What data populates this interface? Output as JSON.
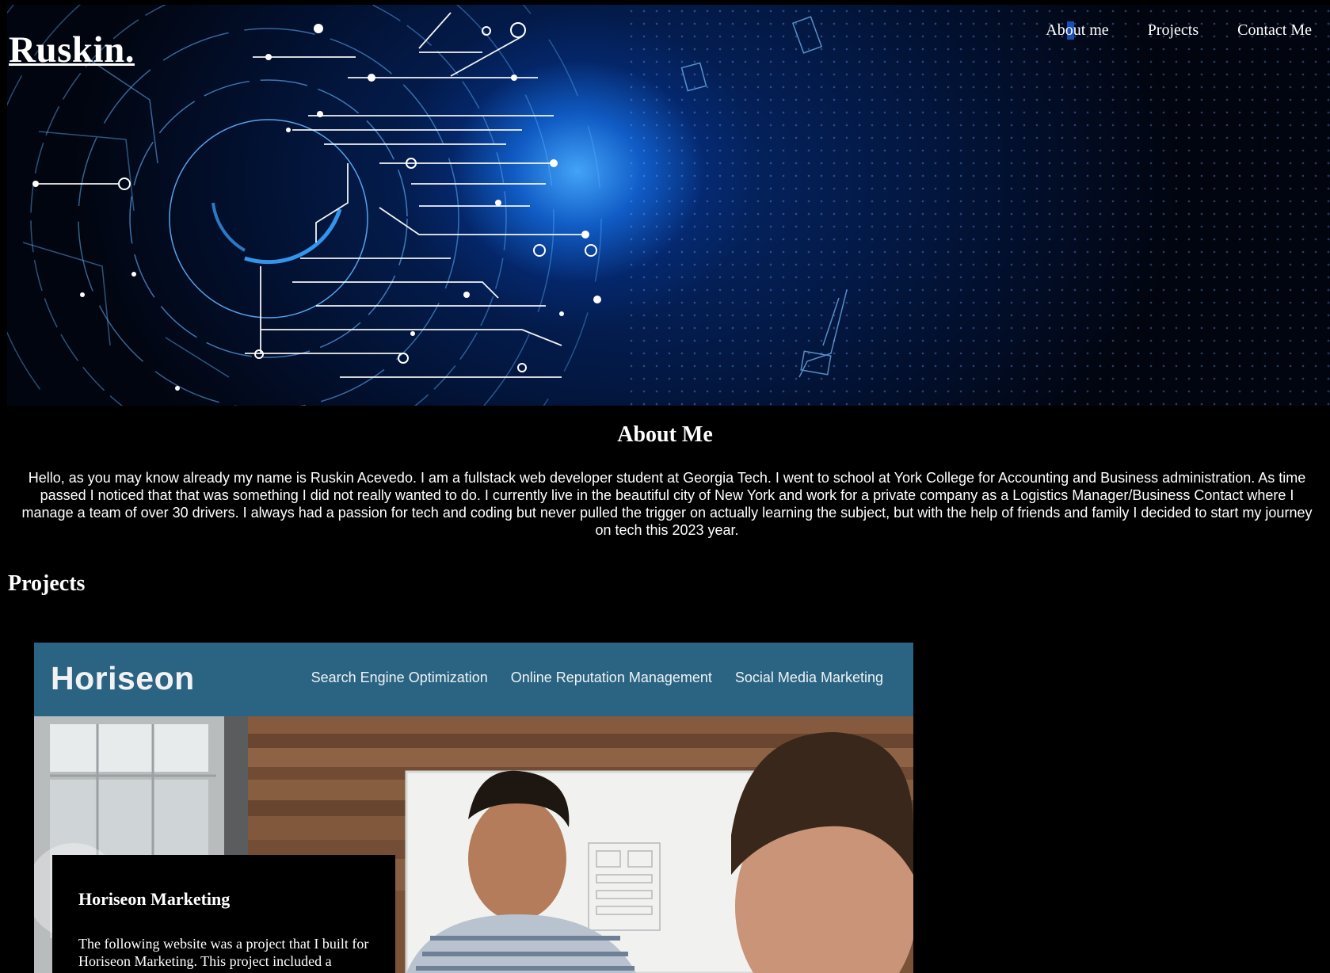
{
  "header": {
    "brand": "Ruskin.",
    "nav": [
      {
        "label": "About me"
      },
      {
        "label": "Projects"
      },
      {
        "label": "Contact Me"
      }
    ]
  },
  "about": {
    "title": "About Me",
    "text": "Hello, as you may know already my name is Ruskin Acevedo. I am a fullstack web developer student at Georgia Tech. I went to school at York College for Accounting and Business administration. As time passed I noticed that that was something I did not really wanted to do. I currently live in the beautiful city of New York and work for a private company as a Logistics Manager/Business Contact where I manage a team of over 30 drivers. I always had a passion for tech and coding but never pulled the trigger on actually learning the subject, but with the help of friends and family I decided to start my journey on tech this 2023 year."
  },
  "projects": {
    "title": "Projects",
    "items": [
      {
        "screenshot": {
          "logo": "Horiseon",
          "nav": [
            "Search Engine Optimization",
            "Online Reputation Management",
            "Social Media Marketing"
          ]
        },
        "title": "Horiseon Marketing",
        "description": "The following website was a project that I built for Horiseon Marketing. This project included a"
      }
    ]
  },
  "colors": {
    "background": "#000000",
    "hero_glow": "#2f9bff",
    "horiseon_header": "#2b6482",
    "selection": "#1d57c9"
  }
}
